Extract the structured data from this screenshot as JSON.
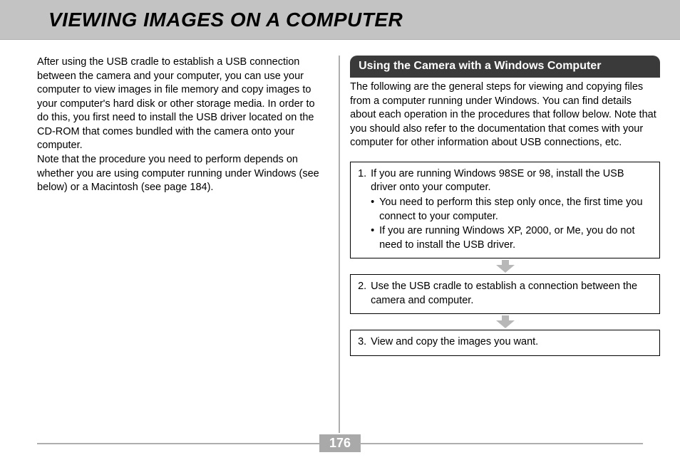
{
  "header": {
    "title": "VIEWING IMAGES ON A COMPUTER"
  },
  "left": {
    "para1": "After using the USB cradle to establish a USB connection between the camera and your computer, you can use your computer to view images in file memory and copy images to your computer's hard disk or other storage media. In order to do this, you first need to install the USB driver located on the CD-ROM that comes bundled with the camera onto your computer.",
    "para2": "Note that the procedure you need to perform depends on whether you are using computer running under Windows (see below) or a Macintosh (see page 184)."
  },
  "right": {
    "section_title": "Using the Camera with a Windows Computer",
    "intro": "The following are the general steps for viewing and copying files from a computer running under Windows. You can find details about each operation in the procedures that follow below. Note that you should also refer to the documentation that comes with your computer for other information about USB connections, etc.",
    "steps": {
      "s1_num": "1.",
      "s1_text": "If you are running Windows 98SE or 98, install the USB driver onto your computer.",
      "s1_b1": "You need to perform this step only once, the first time you connect to your computer.",
      "s1_b2": "If you are running Windows XP, 2000, or Me, you do not need to install the USB driver.",
      "s2_num": "2.",
      "s2_text": "Use the USB cradle to establish a connection between the camera and computer.",
      "s3_num": "3.",
      "s3_text": "View and copy the images you want."
    }
  },
  "page_number": "176",
  "icons": {
    "bullet": "•"
  }
}
